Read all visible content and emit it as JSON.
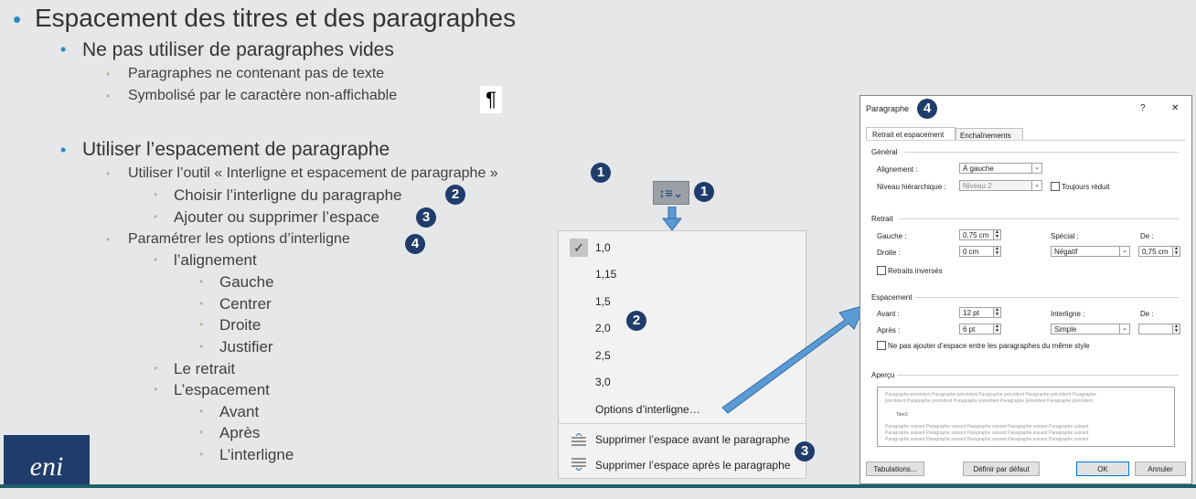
{
  "slide": {
    "title": "Espacement des titres et des paragraphes",
    "b1": "Ne pas utiliser de paragraphes vides",
    "b1_1": "Paragraphes ne contenant pas de texte",
    "b1_2": "Symbolisé par le caractère non-affichable",
    "pilcrow": "¶",
    "b2": "Utiliser l’espacement de paragraphe",
    "b2_1": "Utiliser l’outil « Interligne et espacement de paragraphe »",
    "b2_1_1": "Choisir l’interligne du paragraphe",
    "b2_1_2": "Ajouter ou supprimer l’espace",
    "b2_2": "Paramétrer les options d’interligne",
    "b2_2_1": "l’alignement",
    "align_items": [
      "Gauche",
      "Centrer",
      "Droite",
      "Justifier"
    ],
    "b2_2_2": "Le retrait",
    "b2_2_3": "L’espacement",
    "space_items": [
      "Avant",
      "Après",
      "L’interligne"
    ],
    "logo": "eni"
  },
  "markers": {
    "n1": "1",
    "n2": "2",
    "n3": "3",
    "n4": "4"
  },
  "toolbar": {
    "button_icon": "↕≡⌄"
  },
  "menu": {
    "items": [
      "1,0",
      "1,15",
      "1,5",
      "2,0",
      "2,5",
      "3,0",
      "Options d’interligne…"
    ],
    "remove_before": "Supprimer l’espace avant le paragraphe",
    "remove_after": "Supprimer l’espace après le paragraphe",
    "checked": "✓"
  },
  "dialog": {
    "title": "Paragraphe",
    "help": "?",
    "close": "✕",
    "tab1": "Retrait et espacement",
    "tab2": "Enchaînements",
    "general": "Général",
    "alignment_label": "Alignement :",
    "alignment_value": "À gauche",
    "level_label": "Niveau hiérarchique :",
    "level_value": "Niveau 2",
    "collapsed_label": "Toujours réduit",
    "indent": "Retrait",
    "left_label": "Gauche :",
    "left_value": "0,75 cm",
    "right_label": "Droite :",
    "right_value": "0 cm",
    "special_label": "Spécial :",
    "special_value": "Négatif",
    "by_label": "De :",
    "by_value": "0,75 cm",
    "mirror_label": "Retraits inversés",
    "spacing": "Espacement",
    "before_label": "Avant :",
    "before_value": "12 pt",
    "after_label": "Après :",
    "after_value": "6 pt",
    "line_label": "Interligne :",
    "line_value": "Simple",
    "at_label": "De :",
    "at_value": "",
    "no_space_label": "Ne pas ajouter d’espace entre les paragraphes du même style",
    "preview": "Aperçu",
    "preview_prev1": "Paragraphe précédent Paragraphe précédent Paragraphe précédent Paragraphe précédent Paragraphe",
    "preview_prev2": "précédent Paragraphe précédent Paragraphe précédent Paragraphe précédent Paragraphe précédent",
    "preview_cur": "Titre3",
    "preview_next1": "Paragraphe suivant Paragraphe suivant Paragraphe suivant Paragraphe suivant Paragraphe suivant",
    "preview_next2": "Paragraphe suivant Paragraphe suivant Paragraphe suivant Paragraphe suivant Paragraphe suivant",
    "preview_next3": "Paragraphe suivant Paragraphe suivant Paragraphe suivant Paragraphe suivant Paragraphe suivant",
    "tabs_btn": "Tabulations...",
    "default_btn": "Définir par défaut",
    "ok_btn": "OK",
    "cancel_btn": "Annuler"
  }
}
